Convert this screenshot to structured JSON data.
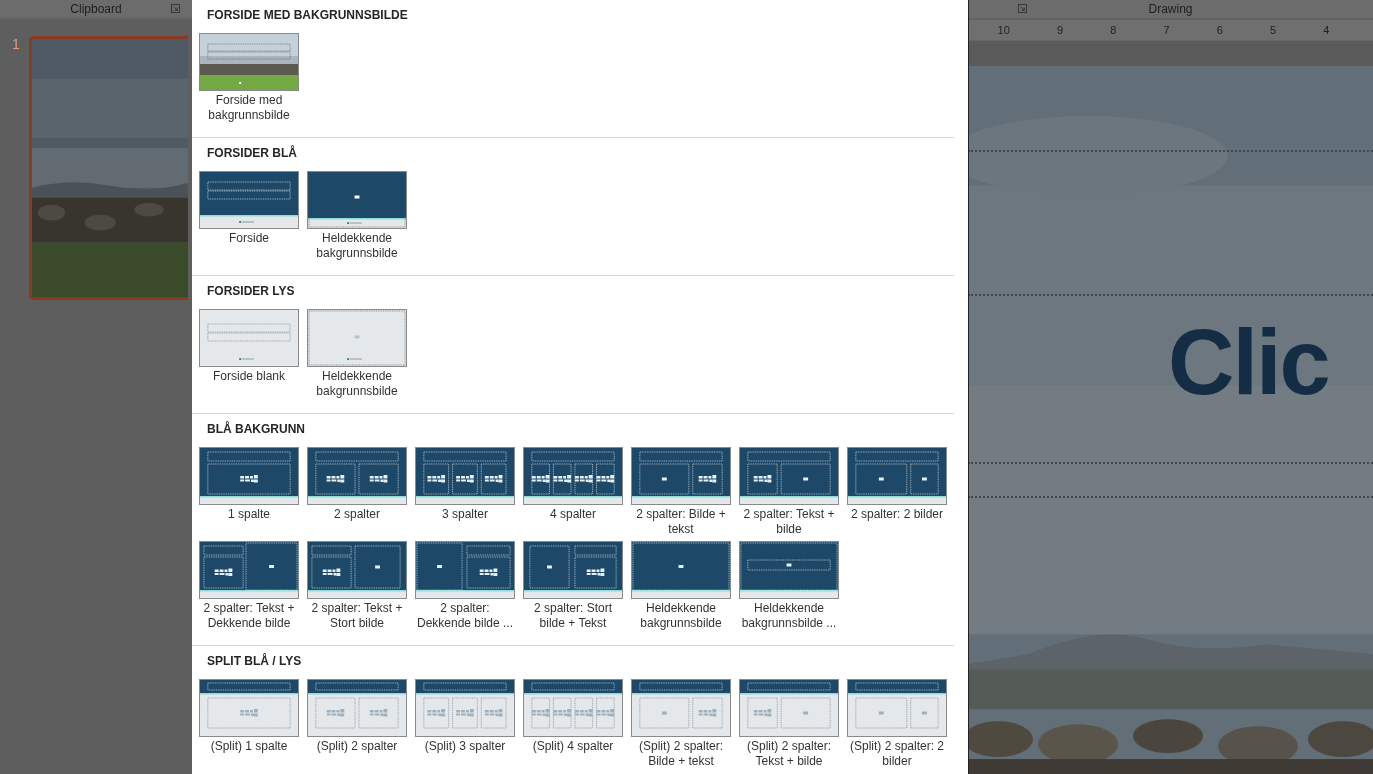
{
  "ribbon": {
    "groups": [
      {
        "label": "Clipboard"
      },
      {
        "label": "Drawing"
      }
    ]
  },
  "slides": [
    {
      "number": "1",
      "selected": true
    }
  ],
  "ruler": [
    "10",
    "9",
    "8",
    "7",
    "6",
    "5",
    "4"
  ],
  "canvas": {
    "title": "Clic"
  },
  "gallery": {
    "sections": [
      {
        "title": "FORSIDE MED BAKGRUNNSBILDE",
        "items": [
          {
            "label": "Forside med bakgrunnsbilde"
          }
        ]
      },
      {
        "title": "FORSIDER BLÅ",
        "items": [
          {
            "label": "Forside",
            "kind": "cover"
          },
          {
            "label": "Heldekkende bakgrunnsbilde",
            "kind": "cover-full"
          }
        ]
      },
      {
        "title": "FORSIDER LYS",
        "items": [
          {
            "label": "Forside blank",
            "kind": "light"
          },
          {
            "label": "Heldekkende bakgrunnsbilde",
            "kind": "light-full"
          }
        ]
      },
      {
        "title": "BLÅ BAKGRUNN",
        "items": [
          {
            "label": "1 spalte",
            "kind": "cols1"
          },
          {
            "label": "2 spalter",
            "kind": "cols2"
          },
          {
            "label": "3 spalter",
            "kind": "cols3"
          },
          {
            "label": "4 spalter",
            "kind": "cols4"
          },
          {
            "label": "2 spalter: Bilde + tekst",
            "kind": "pic-text"
          },
          {
            "label": "2 spalter: Tekst + bilde",
            "kind": "text-pic"
          },
          {
            "label": "2 spalter: 2 bilder",
            "kind": "pics2"
          },
          {
            "label": "2 spalter: Tekst + Dekkende bilde",
            "kind": "text-cover"
          },
          {
            "label": "2 spalter: Tekst + Stort bilde",
            "kind": "text-large"
          },
          {
            "label": "2 spalter: Dekkende bilde ...",
            "kind": "cover-text"
          },
          {
            "label": "2 spalter: Stort bilde + Tekst",
            "kind": "large-text"
          },
          {
            "label": "Heldekkende bakgrunnsbilde",
            "kind": "full"
          },
          {
            "label": "Heldekkende bakgrunnsbilde ...",
            "kind": "full-title"
          }
        ]
      },
      {
        "title": "SPLIT BLÅ / LYS",
        "items": [
          {
            "label": "(Split) 1 spalte",
            "kind": "split-cols1"
          },
          {
            "label": "(Split) 2 spalter",
            "kind": "split-cols2"
          },
          {
            "label": "(Split) 3 spalter",
            "kind": "split-cols3"
          },
          {
            "label": "(Split) 4 spalter",
            "kind": "split-cols4"
          },
          {
            "label": "(Split) 2 spalter: Bilde + tekst",
            "kind": "split-pic-text"
          },
          {
            "label": "(Split) 2 spalter: Tekst + bilde",
            "kind": "split-text-pic"
          },
          {
            "label": "(Split) 2 spalter: 2 bilder",
            "kind": "split-pics2"
          }
        ]
      }
    ]
  }
}
